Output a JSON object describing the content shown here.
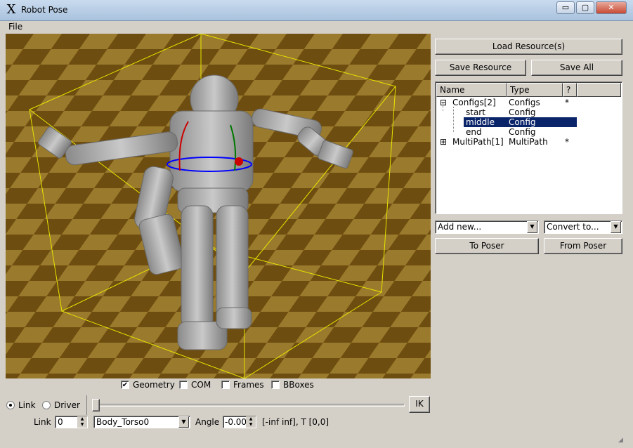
{
  "window": {
    "title": "Robot Pose",
    "minimize": "▭",
    "maximize": "▢",
    "close": "✕"
  },
  "menu": {
    "file": "File"
  },
  "viewport": {
    "floor_dark": "#6e4d10",
    "floor_light": "#9a7a2c",
    "bbox_color": "#e6e600"
  },
  "view_options": [
    {
      "label": "Geometry",
      "checked": true
    },
    {
      "label": "COM",
      "checked": false
    },
    {
      "label": "Frames",
      "checked": false
    },
    {
      "label": "BBoxes",
      "checked": false
    }
  ],
  "mode": {
    "link_label": "Link",
    "driver_label": "Driver",
    "selected": "Link"
  },
  "ik_button": "IK",
  "link_row": {
    "link_label": "Link",
    "link_index": "0",
    "link_name": "Body_Torso0",
    "angle_label": "Angle",
    "angle_value": "-0.00",
    "range_text": "[-inf inf], T [0,0]"
  },
  "right_panel": {
    "load_resources": "Load Resource(s)",
    "save_resource": "Save Resource",
    "save_all": "Save All",
    "columns": {
      "name": "Name",
      "type": "Type",
      "help": "?"
    },
    "tree": [
      {
        "expander": "⊟",
        "name": "Configs[2]",
        "type": "Configs",
        "flag": "*",
        "level": 0
      },
      {
        "name": "start",
        "type": "Config",
        "level": 1
      },
      {
        "name": "middle",
        "type": "Config",
        "level": 1,
        "selected": true
      },
      {
        "name": "end",
        "type": "Config",
        "level": 1
      },
      {
        "expander": "⊞",
        "name": "MultiPath[1]",
        "type": "MultiPath",
        "flag": "*",
        "level": 0
      }
    ],
    "add_new": "Add new...",
    "convert_to": "Convert to...",
    "to_poser": "To Poser",
    "from_poser": "From Poser"
  }
}
